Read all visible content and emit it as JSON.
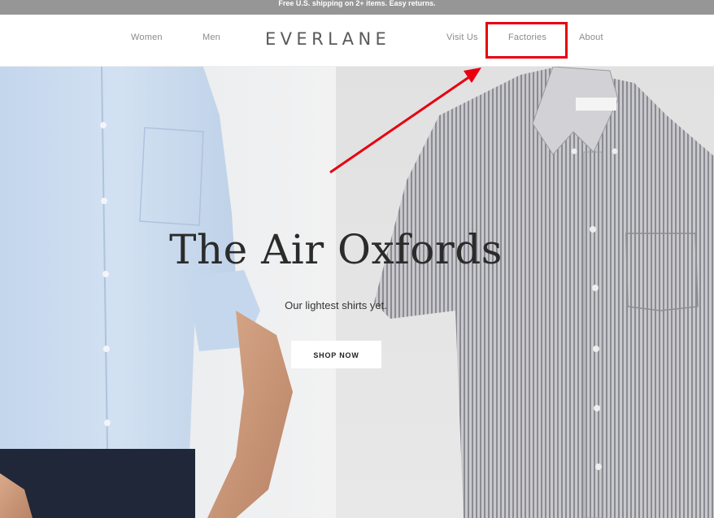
{
  "announcement": {
    "text": "Free U.S. shipping on 2+ items. Easy returns."
  },
  "header": {
    "logo": "EVERLANE",
    "nav_left": [
      {
        "label": "Women"
      },
      {
        "label": "Men"
      }
    ],
    "nav_right": [
      {
        "label": "Visit Us"
      },
      {
        "label": "Factories"
      },
      {
        "label": "About"
      }
    ]
  },
  "hero": {
    "title": "The Air Oxfords",
    "subtitle": "Our lightest shirts yet.",
    "cta_label": "SHOP NOW"
  },
  "annotation": {
    "highlight_color": "#e8000f",
    "target": "Factories"
  },
  "colors": {
    "header_bg": "#ffffff",
    "announcement_bg": "#969696",
    "nav_text": "#8a8a8a",
    "logo_text": "#5a5a5a"
  }
}
